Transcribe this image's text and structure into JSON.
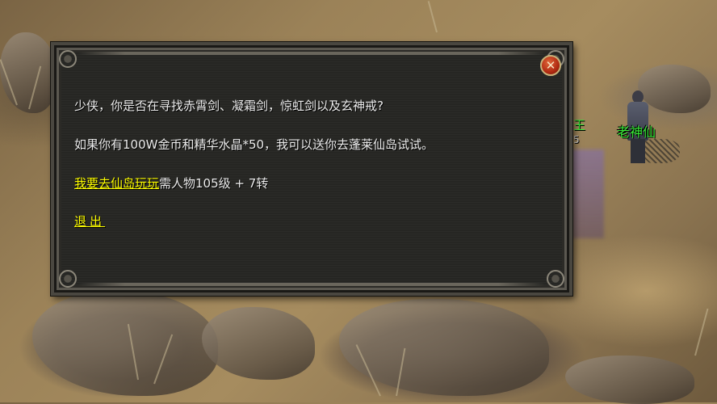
{
  "dialog": {
    "line1": "少侠，你是否在寻找赤霄剑、凝霜剑，惊虹剑以及玄神戒?",
    "line2": "如果你有100W金币和精华水晶*50，我可以送你去蓬莱仙岛试试。",
    "option_link": "我要去仙岛玩玩",
    "option_requirement": "需人物105级 + 7转",
    "exit_link": "退出",
    "close_icon": "close-icon"
  },
  "scene": {
    "npc_name": "老神仙",
    "partial_name": "王",
    "partial_number": "5"
  },
  "colors": {
    "link": "#ffff00",
    "npc_name": "#38e838",
    "dialog_text": "#ececec",
    "close_button": "#c0391b"
  }
}
